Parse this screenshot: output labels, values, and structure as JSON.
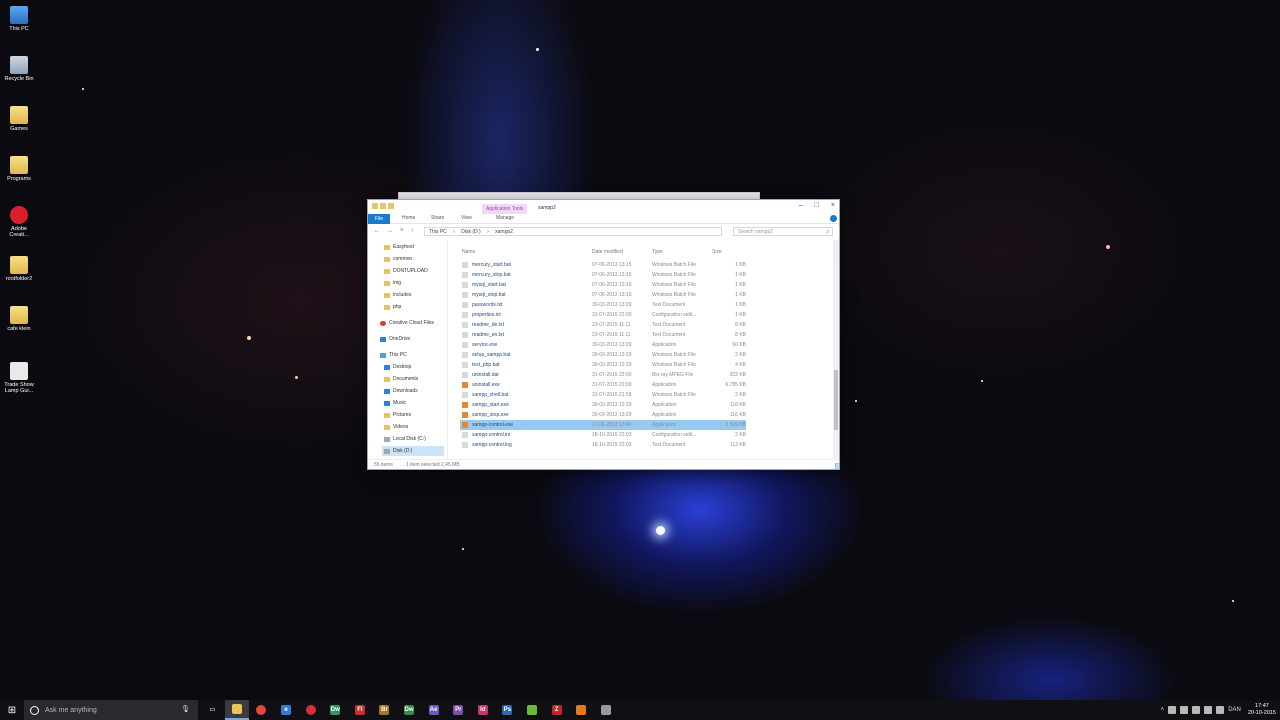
{
  "desktop": {
    "icons": [
      {
        "label": "This PC",
        "icon": "pc-icon"
      },
      {
        "label": "Recycle Bin",
        "icon": "recycle-bin-icon"
      },
      {
        "label": "Games",
        "icon": "folder-icon"
      },
      {
        "label": "Programs",
        "icon": "folder-icon"
      },
      {
        "label": "Adobe Creati...",
        "icon": "adobe-icon"
      },
      {
        "label": "rootfolder2",
        "icon": "folder-icon"
      },
      {
        "label": "cafe klein",
        "icon": "folder-icon"
      },
      {
        "label": "Trade Show Lamp Gui...",
        "icon": "document-icon"
      }
    ]
  },
  "explorer": {
    "context_tab": "Application Tools",
    "window_title": "xampp2",
    "controls": {
      "minimize": "–",
      "maximize": "□",
      "close": "×"
    },
    "ribbon": {
      "file": "File",
      "home": "Home",
      "share": "Share",
      "view": "View",
      "manage": "Manage"
    },
    "address": {
      "crumbs": [
        "This PC",
        "›",
        "Disk (D:)",
        "›",
        "xampp2"
      ]
    },
    "search_placeholder": "Search xampp2",
    "nav": [
      {
        "label": "Easyfood",
        "icon": "folder-icon"
      },
      {
        "label": "common",
        "icon": "folder-icon"
      },
      {
        "label": "DONTUPLOAD",
        "icon": "folder-icon"
      },
      {
        "label": "img",
        "icon": "folder-icon"
      },
      {
        "label": "includes",
        "icon": "folder-icon"
      },
      {
        "label": "php",
        "icon": "folder-icon"
      },
      {
        "label": "Creative Cloud Files",
        "icon": "creative-cloud-icon"
      },
      {
        "label": "OneDrive",
        "icon": "onedrive-icon"
      },
      {
        "label": "This PC",
        "icon": "pc-icon"
      },
      {
        "label": "Desktop",
        "icon": "desktop-icon"
      },
      {
        "label": "Documents",
        "icon": "documents-icon"
      },
      {
        "label": "Downloads",
        "icon": "downloads-icon"
      },
      {
        "label": "Music",
        "icon": "music-icon"
      },
      {
        "label": "Pictures",
        "icon": "pictures-icon"
      },
      {
        "label": "Videos",
        "icon": "videos-icon"
      },
      {
        "label": "Local Disk (C:)",
        "icon": "drive-icon"
      },
      {
        "label": "Disk (D:)",
        "icon": "drive-icon"
      }
    ],
    "columns": {
      "name": "Name",
      "date": "Date modified",
      "type": "Type",
      "size": "Size"
    },
    "files": [
      {
        "name": "mercury_start.bat",
        "date": "07-06-2013 13:15",
        "type": "Windows Batch File",
        "size": "1 KB"
      },
      {
        "name": "mercury_stop.bat",
        "date": "07-06-2013 13:15",
        "type": "Windows Batch File",
        "size": "1 KB"
      },
      {
        "name": "mysql_start.bat",
        "date": "07-06-2013 13:15",
        "type": "Windows Batch File",
        "size": "1 KB"
      },
      {
        "name": "mysql_stop.bat",
        "date": "07-06-2013 13:15",
        "type": "Windows Batch File",
        "size": "1 KB"
      },
      {
        "name": "passwords.txt",
        "date": "30-03-2013 13:29",
        "type": "Text Document",
        "size": "1 KB"
      },
      {
        "name": "properties.ini",
        "date": "31-07-2015 22:00",
        "type": "Configuration setti...",
        "size": "1 KB"
      },
      {
        "name": "readme_de.txt",
        "date": "23-07-2015 11:11",
        "type": "Text Document",
        "size": "8 KB"
      },
      {
        "name": "readme_en.txt",
        "date": "23-07-2015 11:11",
        "type": "Text Document",
        "size": "8 KB"
      },
      {
        "name": "service.exe",
        "date": "30-03-2013 13:29",
        "type": "Application",
        "size": "60 KB"
      },
      {
        "name": "setup_xampp.bat",
        "date": "30-03-2013 13:29",
        "type": "Windows Batch File",
        "size": "2 KB"
      },
      {
        "name": "test_php.bat",
        "date": "30-03-2013 13:29",
        "type": "Windows Batch File",
        "size": "4 KB"
      },
      {
        "name": "uninstall.dat",
        "date": "31-07-2015 22:00",
        "type": "Blu-ray MPEG File",
        "size": "202 KB"
      },
      {
        "name": "uninstall.exe",
        "date": "31-07-2015 22:00",
        "type": "Application",
        "size": "6.785 KB"
      },
      {
        "name": "xampp_shell.bat",
        "date": "31-07-2015 21:58",
        "type": "Windows Batch File",
        "size": "2 KB"
      },
      {
        "name": "xampp_start.exe",
        "date": "30-03-2013 13:29",
        "type": "Application",
        "size": "116 KB"
      },
      {
        "name": "xampp_stop.exe",
        "date": "30-03-2013 13:29",
        "type": "Application",
        "size": "116 KB"
      },
      {
        "name": "xampp-control.exe",
        "date": "17-06-2013 13:42",
        "type": "Application",
        "size": "2.509 KB"
      },
      {
        "name": "xampp-control.ini",
        "date": "18-10-2015 22:03",
        "type": "Configuration setti...",
        "size": "2 KB"
      },
      {
        "name": "xampp-control.log",
        "date": "18-10-2015 22:03",
        "type": "Text Document",
        "size": "113 KB"
      }
    ],
    "status": {
      "count": "55 items",
      "selected": "1 item selected  2,45 MB"
    }
  },
  "taskbar": {
    "search_placeholder": "Ask me anything",
    "apps": [
      {
        "name": "task-view-icon",
        "color": "#cfcfcf",
        "glyph": "▭"
      },
      {
        "name": "file-explorer-icon",
        "color": "#e8c35a",
        "glyph": ""
      },
      {
        "name": "chrome-icon",
        "color": "#e34a3a",
        "glyph": ""
      },
      {
        "name": "edge-icon",
        "color": "#2d7fd3",
        "glyph": "e"
      },
      {
        "name": "creative-cloud-icon",
        "color": "#d4303a",
        "glyph": ""
      },
      {
        "name": "dreamweaver-icon",
        "color": "#2f9a5c",
        "glyph": "Dw"
      },
      {
        "name": "flash-icon",
        "color": "#c0302a",
        "glyph": "Fl"
      },
      {
        "name": "bridge-icon",
        "color": "#a17a1e",
        "glyph": "Br"
      },
      {
        "name": "dreamweaver-2-icon",
        "color": "#2f8a4c",
        "glyph": "Dw"
      },
      {
        "name": "after-effects-icon",
        "color": "#6a5ac8",
        "glyph": "Ae"
      },
      {
        "name": "premiere-icon",
        "color": "#7a4fb0",
        "glyph": "Pr"
      },
      {
        "name": "indesign-icon",
        "color": "#c23a6a",
        "glyph": "Id"
      },
      {
        "name": "photoshop-icon",
        "color": "#2a6ab0",
        "glyph": "Ps"
      },
      {
        "name": "android-icon",
        "color": "#6fb83a",
        "glyph": ""
      },
      {
        "name": "filezilla-icon",
        "color": "#c8222a",
        "glyph": "Z"
      },
      {
        "name": "xampp-icon",
        "color": "#e07a1f",
        "glyph": ""
      },
      {
        "name": "app-window-icon",
        "color": "#9a9a9a",
        "glyph": ""
      }
    ],
    "language": "DAN",
    "time": "17:47",
    "date": "20-10-2015"
  }
}
